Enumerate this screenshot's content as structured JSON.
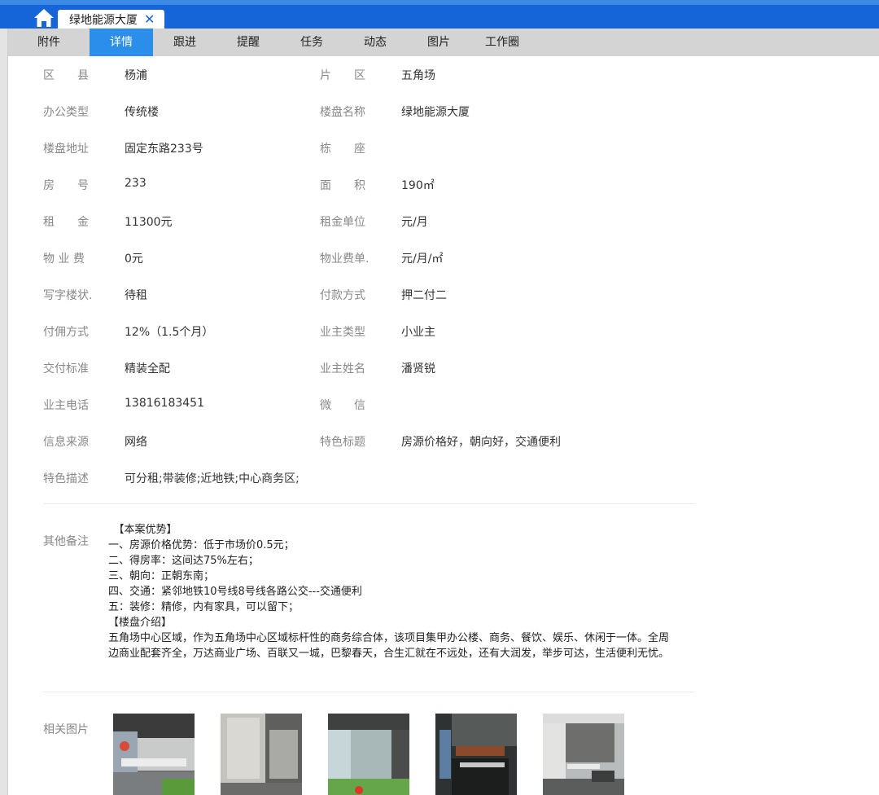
{
  "tabbar": {
    "home_icon": "home-icon",
    "open_tab_title": "绿地能源大厦",
    "close_icon": "close-icon"
  },
  "subnav": [
    "附件",
    "详情",
    "跟进",
    "提醒",
    "任务",
    "动态",
    "图片",
    "工作圈"
  ],
  "subnav_active": "详情",
  "details": [
    {
      "l1": "区　　县",
      "v1": "杨浦",
      "l2": "片　　区",
      "v2": "五角场"
    },
    {
      "l1": "办公类型",
      "v1": "传统楼",
      "l2": "楼盘名称",
      "v2": "绿地能源大厦"
    },
    {
      "l1": "楼盘地址",
      "v1": "固定东路233号",
      "l2": "栋　　座",
      "v2": ""
    },
    {
      "l1": "房　　号",
      "v1": "233",
      "l2": "面　　积",
      "v2": "190㎡"
    },
    {
      "l1": "租　　金",
      "v1": "11300元",
      "l2": "租金单位",
      "v2": "元/月"
    },
    {
      "l1": "物 业 费",
      "v1": "0元",
      "l2": "物业费单.",
      "v2": "元/月/㎡"
    },
    {
      "l1": "写字楼状.",
      "v1": "待租",
      "l2": "付款方式",
      "v2": "押二付二"
    },
    {
      "l1": "付佣方式",
      "v1": "12%（1.5个月）",
      "l2": "业主类型",
      "v2": "小业主"
    },
    {
      "l1": "交付标准",
      "v1": "精装全配",
      "l2": "业主姓名",
      "v2": "潘贤锐"
    },
    {
      "l1": "业主电话",
      "v1": "13816183451",
      "l2": "微　　信",
      "v2": ""
    },
    {
      "l1": "信息来源",
      "v1": "网络",
      "l2": "特色标题",
      "v2": "房源价格好，朝向好，交通便利"
    },
    {
      "l1": "特色描述",
      "v1": "可分租;带装修;近地铁;中心商务区;",
      "l2": "",
      "v2": ""
    }
  ],
  "notes": {
    "label": "其他备注",
    "lines": [
      "　【本案优势】",
      "一、房源价格优势：低于市场价0.5元；",
      "二、得房率：这间达75%左右；",
      "三、朝向：正朝东南；",
      "四、交通：紧邻地铁10号线8号线各路公交---交通便利",
      "五：装修：精修，内有家具，可以留下；",
      "【楼盘介绍】"
    ],
    "paragraph": "五角场中心区域，作为五角场中心区域标杆性的商务综合体，该项目集甲办公楼、商务、餐饮、娱乐、休闲于一体。全周边商业配套齐全，万达商业广场、百联又一城，巴黎春天，合生汇就在不远处，还有大润发，举步可达，生活便利无忧。"
  },
  "pictures": {
    "label": "相关图片",
    "count": 5
  }
}
